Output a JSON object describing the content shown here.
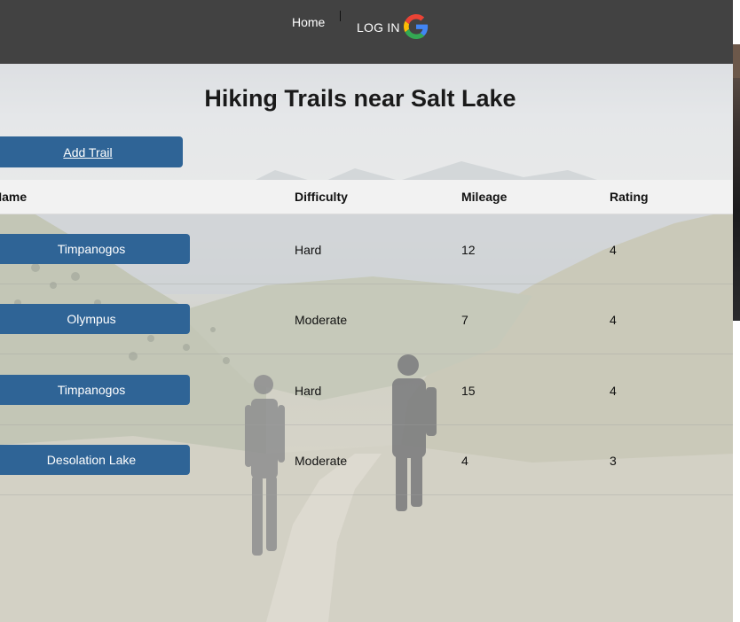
{
  "nav": {
    "home_label": "Home",
    "login_label": "LOG IN"
  },
  "page": {
    "title": "Hiking Trails near Salt Lake",
    "add_trail_label": "Add Trail"
  },
  "table": {
    "headers": [
      "Name",
      "Difficulty",
      "Mileage",
      "Rating"
    ],
    "rows": [
      {
        "name": "Timpanogos",
        "difficulty": "Hard",
        "mileage": "12",
        "rating": "4"
      },
      {
        "name": "Olympus",
        "difficulty": "Moderate",
        "mileage": "7",
        "rating": "4"
      },
      {
        "name": "Timpanogos",
        "difficulty": "Hard",
        "mileage": "15",
        "rating": "4"
      },
      {
        "name": "Desolation Lake",
        "difficulty": "Moderate",
        "mileage": "4",
        "rating": "3"
      }
    ]
  },
  "colors": {
    "navbar": "#424242",
    "button": "#2f6496",
    "header_row": "#f2f2f2"
  },
  "icons": {
    "login": "google-g-icon"
  }
}
